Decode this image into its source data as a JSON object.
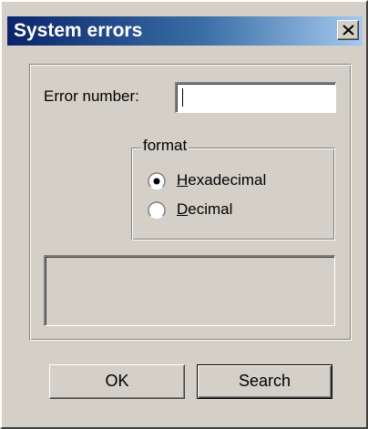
{
  "window": {
    "title": "System errors",
    "close_icon": "close-icon"
  },
  "form": {
    "error_number_label": "Error number:",
    "error_number_value": "",
    "format_group_label": "format",
    "radio_hex_label": "Hexadecimal",
    "radio_dec_label": "Decimal",
    "selected_format": "Hexadecimal",
    "result_text": ""
  },
  "buttons": {
    "ok_label": "OK",
    "search_label": "Search"
  },
  "colors": {
    "titlebar_start": "#0a246a",
    "titlebar_end": "#a6caf0",
    "dialog_bg": "#d4d0c8"
  }
}
